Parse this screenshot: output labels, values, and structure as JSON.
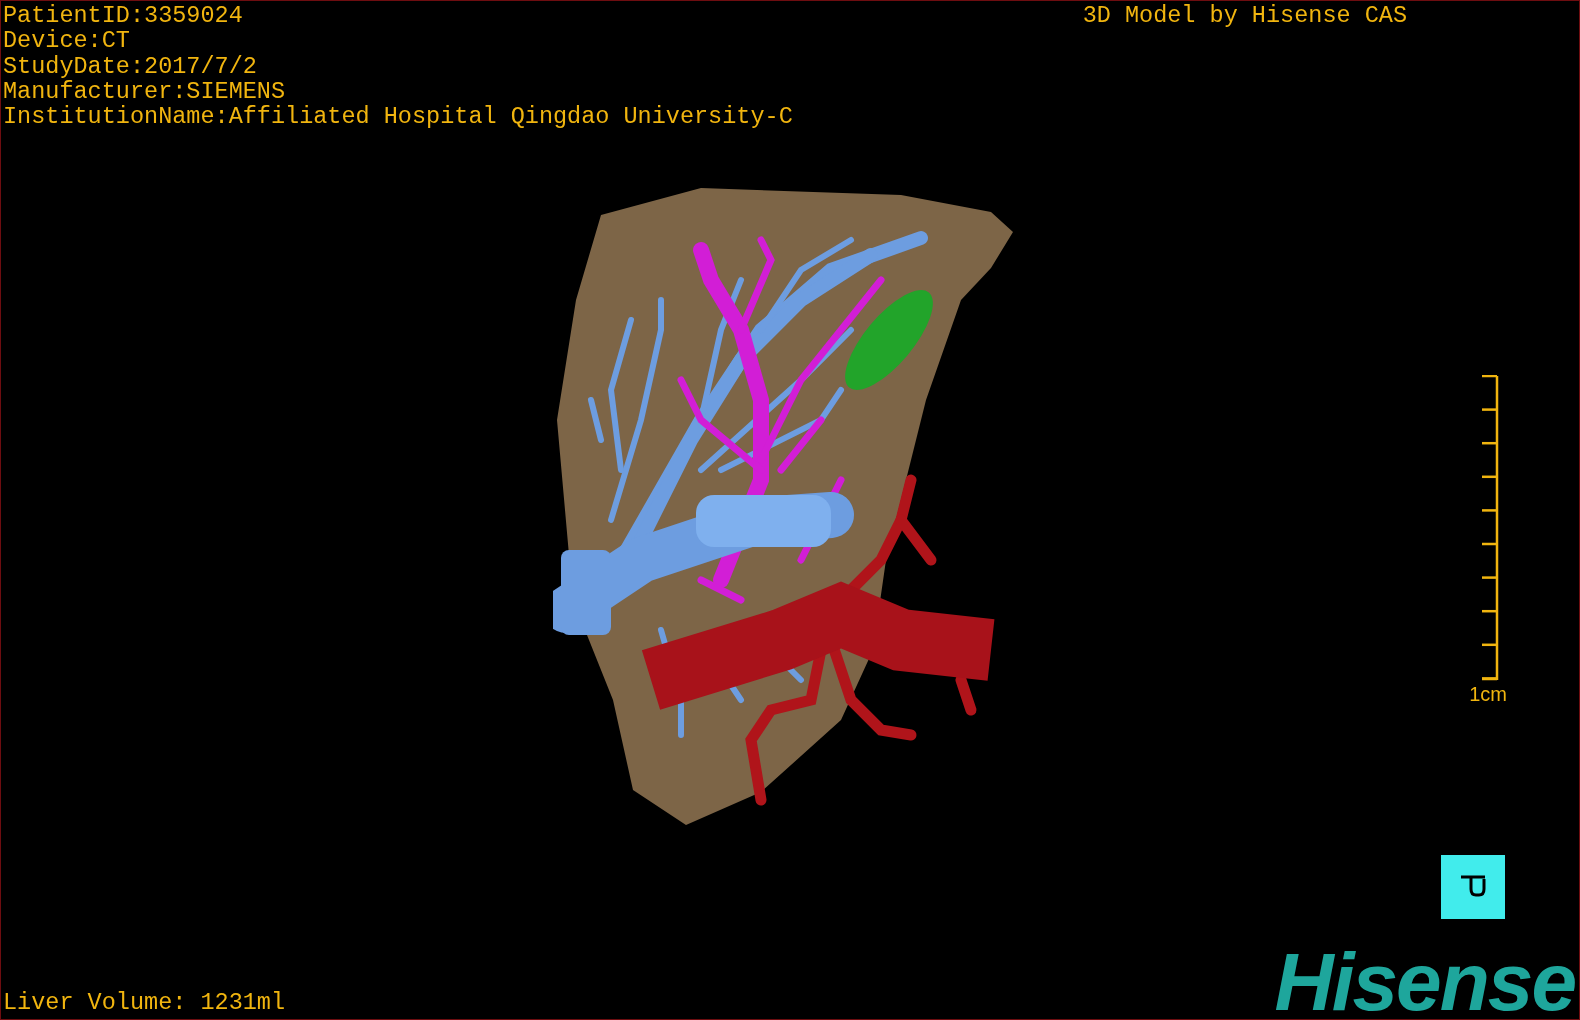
{
  "patient_info": [
    "PatientID:3359024",
    "Device:CT",
    "StudyDate:2017/7/2",
    "Manufacturer:SIEMENS",
    "InstitutionName:Affiliated Hospital Qingdao University-C"
  ],
  "title": "3D Model by Hisense CAS",
  "scale_bar": {
    "label": "1cm"
  },
  "liver_volume": "Liver Volume: 1231ml",
  "brand": "Hisense"
}
